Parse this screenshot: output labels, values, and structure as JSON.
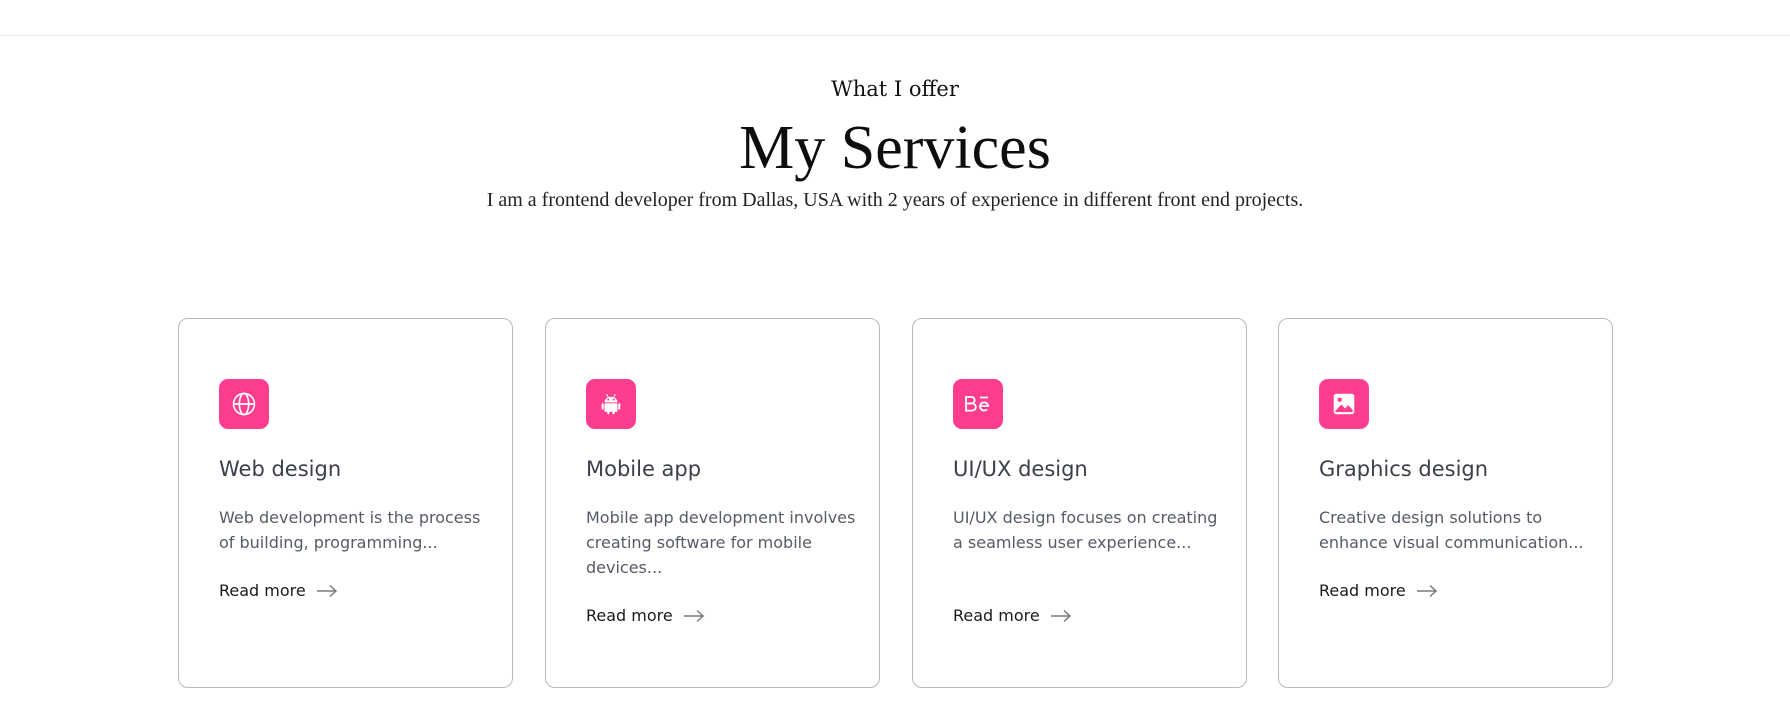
{
  "header": {
    "eyebrow": "What I offer",
    "title": "My Services",
    "intro": "I am a frontend developer from Dallas, USA with 2 years of experience in different front end projects."
  },
  "services": [
    {
      "icon": "globe-icon",
      "title": "Web design",
      "description": "Web development is the process of building, programming...",
      "link_label": "Read more"
    },
    {
      "icon": "android-icon",
      "title": "Mobile app",
      "description": "Mobile app development involves creating software for mobile devices...",
      "link_label": "Read more"
    },
    {
      "icon": "behance-icon",
      "title": "UI/UX design",
      "description": "UI/UX design focuses on creating a seamless user experience...",
      "link_label": "Read more"
    },
    {
      "icon": "image-icon",
      "title": "Graphics design",
      "description": "Creative design solutions to enhance visual communication...",
      "link_label": "Read more"
    }
  ],
  "colors": {
    "accent": "#ff3d8f",
    "card_border": "#b8b8bf",
    "title_text": "#3b3f4a",
    "body_text": "#565b66"
  }
}
